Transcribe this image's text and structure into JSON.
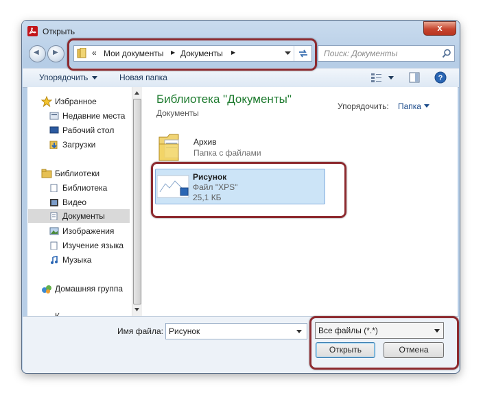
{
  "window": {
    "title": "Открыть",
    "close_symbol": "x"
  },
  "nav": {
    "back_symbol": "◀",
    "forward_symbol": "▶"
  },
  "address": {
    "prefix": "«",
    "crumbs": [
      "Мои документы",
      "Документы"
    ],
    "separator": "▶"
  },
  "search": {
    "placeholder": "Поиск: Документы"
  },
  "toolbar": {
    "organize_label": "Упорядочить",
    "new_folder_label": "Новая папка"
  },
  "sidebar": {
    "favorites_label": "Избранное",
    "favorites": [
      "Недавние места",
      "Рабочий стол",
      "Загрузки"
    ],
    "libraries_label": "Библиотеки",
    "libraries": [
      "Библиотека",
      "Видео",
      "Документы",
      "Изображения",
      "Изучение языка",
      "Музыка"
    ],
    "homegroup_label": "Домашняя группа",
    "cut_item": "К..."
  },
  "content": {
    "title": "Библиотека \"Документы\"",
    "subtitle": "Документы",
    "arrange_label": "Упорядочить:",
    "arrange_value": "Папка",
    "files": [
      {
        "name": "Архив",
        "type": "Папка с файлами",
        "size": ""
      },
      {
        "name": "Рисунок",
        "type": "Файл \"XPS\"",
        "size": "25,1 КБ"
      }
    ]
  },
  "bottom": {
    "filename_label": "Имя файла:",
    "filename_value": "Рисунок",
    "filter_value": "Все файлы (*.*)",
    "open_label": "Открыть",
    "cancel_label": "Отмена"
  },
  "colors": {
    "accent_green": "#1e7b2f",
    "link_blue": "#1a4a8a",
    "highlight": "#8d2a2f"
  }
}
